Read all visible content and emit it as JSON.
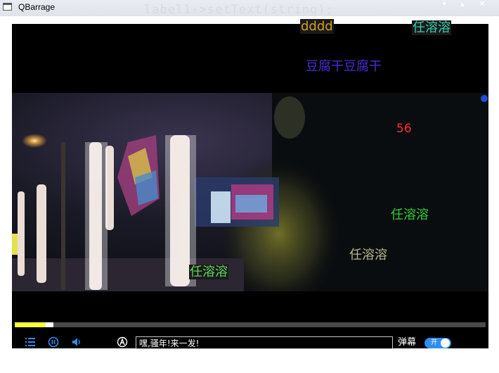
{
  "window": {
    "title": "QBarrage",
    "background_code_fragment": "label1->setText(string);"
  },
  "barrage": [
    {
      "text": "dddd",
      "color": "#d4a017",
      "highlight": true
    },
    {
      "text": "任溶溶",
      "color": "#35d0b0",
      "highlight": true
    },
    {
      "text": "豆腐干豆腐干",
      "color": "#4b2bd6",
      "highlight": false
    },
    {
      "text": "56",
      "color": "#ff2a3a",
      "highlight": false
    },
    {
      "text": "任溶溶",
      "color": "#2fd12f",
      "highlight": false
    },
    {
      "text": "任溶溶",
      "color": "#b9b98a",
      "highlight": false
    },
    {
      "text": "任溶溶",
      "color": "#5fd65f",
      "highlight": true
    }
  ],
  "player": {
    "progress": 0.065,
    "buffered": 0.082,
    "icons": {
      "playlist": "playlist-icon",
      "pause": "pause-icon",
      "volume": "volume-icon",
      "font": "font-style-icon"
    },
    "accent_color": "#2f8ef0"
  },
  "comment": {
    "value": "嘿,骚年!来一发!"
  },
  "danmu_toggle": {
    "label": "弹幕",
    "state_label": "开",
    "on": true
  }
}
